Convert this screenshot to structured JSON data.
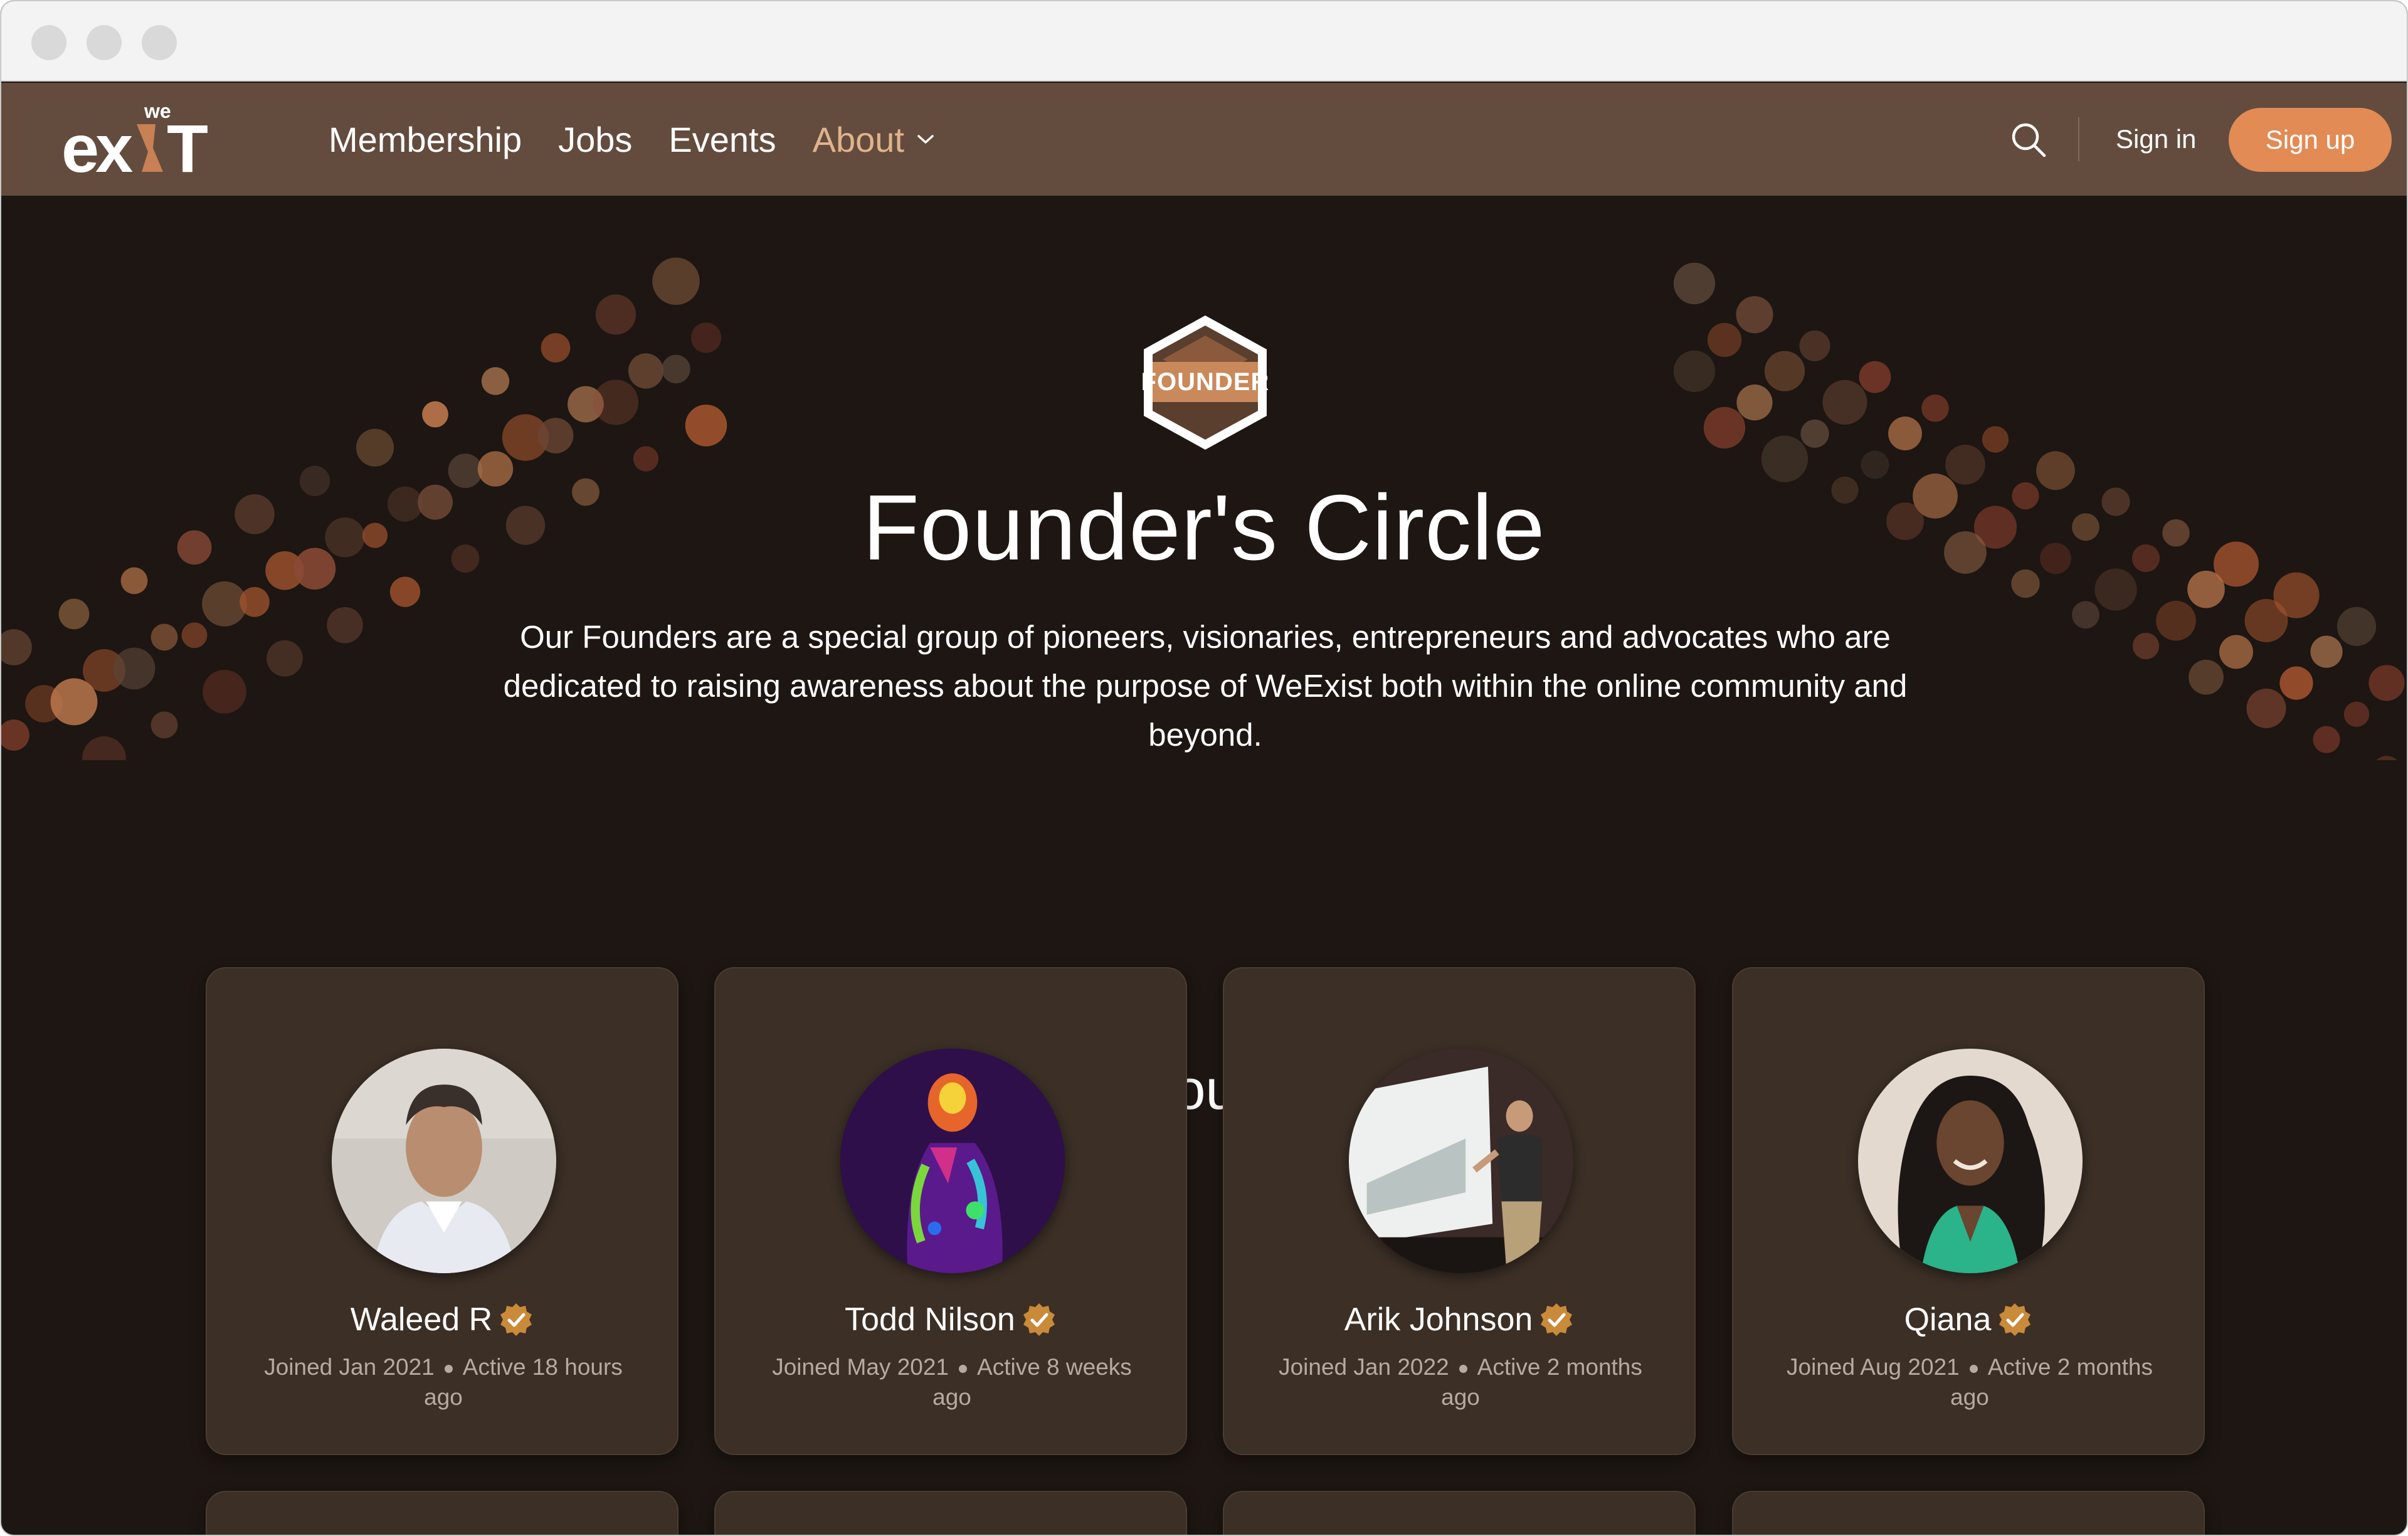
{
  "nav": {
    "logo_small": "we",
    "logo_main": "exist",
    "links": [
      {
        "label": "Membership"
      },
      {
        "label": "Jobs"
      },
      {
        "label": "Events"
      },
      {
        "label": "About"
      }
    ],
    "signin_label": "Sign in",
    "signup_label": "Sign up"
  },
  "hero": {
    "badge_text": "FOUNDER",
    "title": "Founder's Circle",
    "description": "Our Founders are a special group of pioneers, visionaries, entrepreneurs and advocates who are dedicated to raising awareness about the purpose of WeExist both within the online community and beyond."
  },
  "founders": {
    "title": "Our Founders",
    "members": [
      {
        "name": "Waleed R",
        "joined": "Joined Jan 2021",
        "active": "Active 18 hours ago"
      },
      {
        "name": "Todd Nilson",
        "joined": "Joined May 2021",
        "active": "Active 8 weeks ago"
      },
      {
        "name": "Arik Johnson",
        "joined": "Joined Jan 2022",
        "active": "Active 2 months ago"
      },
      {
        "name": "Qiana",
        "joined": "Joined Aug 2021",
        "active": "Active 2 months ago"
      }
    ]
  },
  "colors": {
    "nav_bg": "#634c3e",
    "page_bg": "#1d1612",
    "card_bg": "#3b2f26",
    "accent": "#e28b55",
    "active_link": "#dfb48b",
    "verified": "#c98a3a"
  },
  "icons": {
    "search": "search-icon",
    "chevron": "chevron-down-icon",
    "verified": "verified-badge-icon"
  }
}
